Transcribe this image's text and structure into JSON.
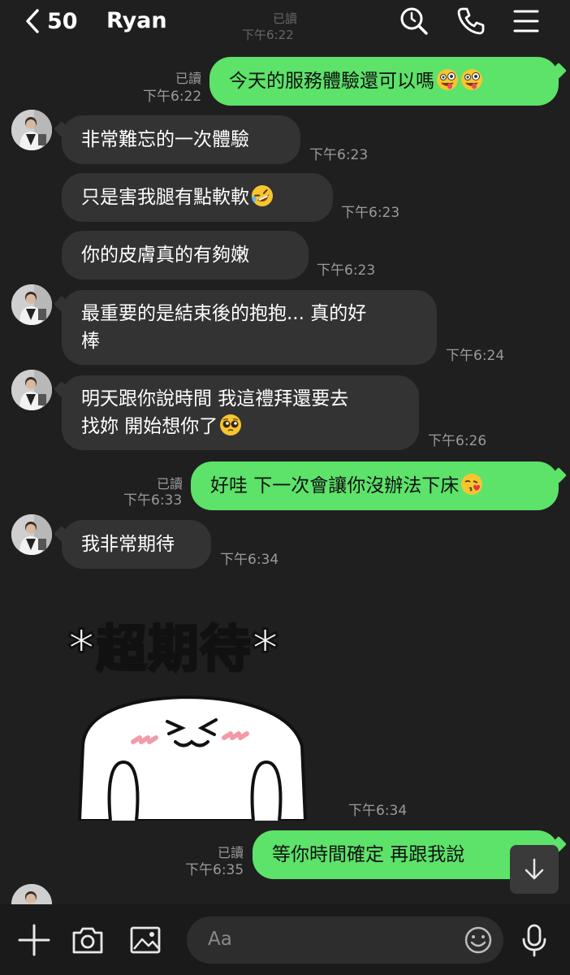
{
  "header": {
    "back_count": "50",
    "title": "Ryan",
    "ghost_read": "已讀",
    "ghost_time": "下午6:22"
  },
  "messages": [
    {
      "dir": "out",
      "text": "今天的服務體驗還可以嗎",
      "emojis": [
        "zany-face",
        "zany-face"
      ],
      "read": "已讀",
      "time": "下午6:22"
    },
    {
      "dir": "in",
      "text": "非常難忘的一次體驗",
      "time": "下午6:23"
    },
    {
      "dir": "in",
      "text": "只是害我腿有點軟軟",
      "emojis": [
        "rofl-face"
      ],
      "time": "下午6:23"
    },
    {
      "dir": "in",
      "text": "你的皮膚真的有夠嫩",
      "time": "下午6:23"
    },
    {
      "dir": "in",
      "text_line1": "最重要的是結束後的抱抱... 真的好",
      "text_line2": "棒",
      "time": "下午6:24"
    },
    {
      "dir": "in",
      "text_line1": "明天跟你說時間 我這禮拜還要去",
      "text_line2": "找妳 開始想你了",
      "emojis": [
        "pleading-face"
      ],
      "time": "下午6:26"
    },
    {
      "dir": "out",
      "text": "好哇 下一次會讓你沒辦法下床",
      "emojis": [
        "kissing-face"
      ],
      "read": "已讀",
      "time": "下午6:33"
    },
    {
      "dir": "in",
      "text": "我非常期待",
      "time": "下午6:34"
    },
    {
      "dir": "in",
      "type": "sticker",
      "sticker_text": "*超期待*",
      "time": "下午6:34"
    },
    {
      "dir": "out",
      "text": "等你時間確定 再跟我說",
      "read": "已讀",
      "time": "下午6:35"
    }
  ],
  "composer": {
    "placeholder": "Aa"
  },
  "colors": {
    "background": "#1f1f1f",
    "incoming_bubble": "#333333",
    "outgoing_bubble": "#5de26a",
    "meta_text": "#9a9a9a"
  },
  "icons": [
    "back-chevron-icon",
    "search-icon",
    "phone-icon",
    "menu-icon",
    "plus-icon",
    "camera-icon",
    "image-icon",
    "emoji-icon",
    "mic-icon",
    "scroll-down-icon"
  ]
}
